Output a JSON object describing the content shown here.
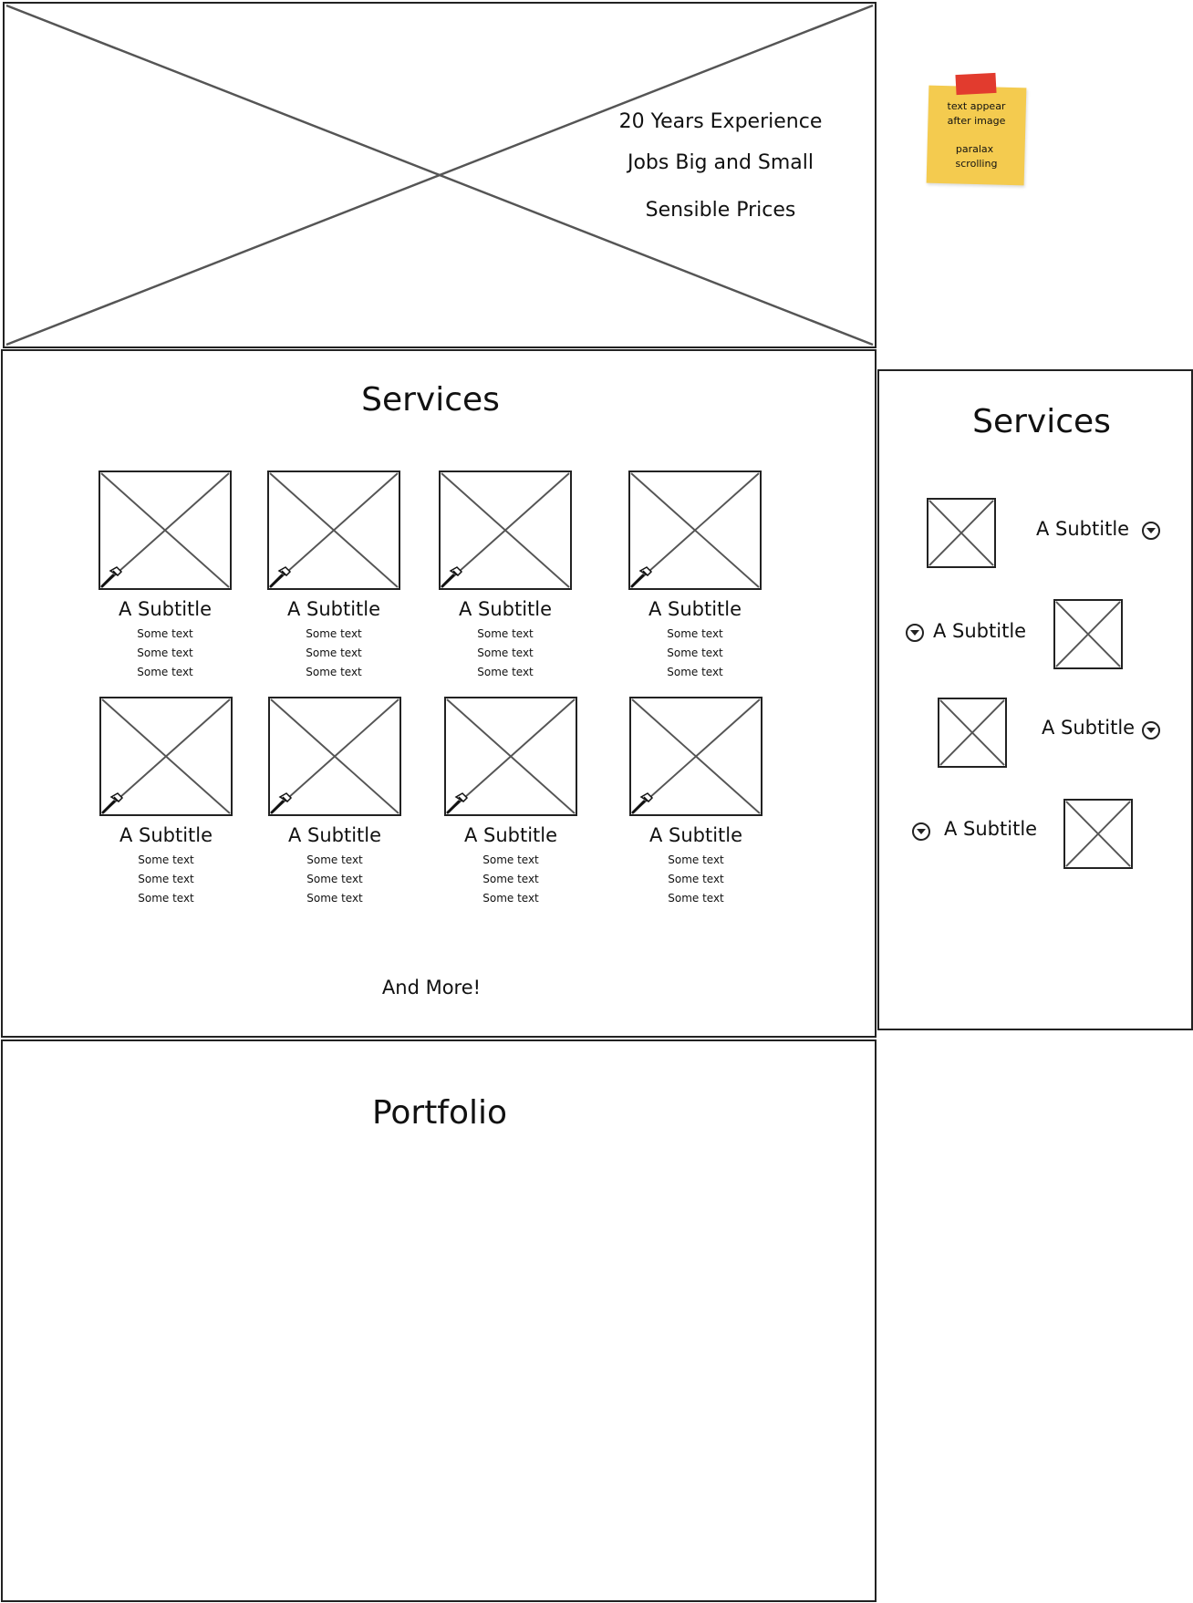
{
  "hero": {
    "lines": [
      "20 Years Experience",
      "Jobs Big and Small",
      "Sensible Prices"
    ]
  },
  "sticky_note": {
    "line1": "text appear",
    "line2": "after image",
    "line3": "paralax",
    "line4": "scrolling"
  },
  "services": {
    "title": "Services",
    "cards": [
      {
        "subtitle": "A Subtitle",
        "texts": [
          "Some text",
          "Some text",
          "Some text"
        ]
      },
      {
        "subtitle": "A Subtitle",
        "texts": [
          "Some text",
          "Some text",
          "Some text"
        ]
      },
      {
        "subtitle": "A Subtitle",
        "texts": [
          "Some text",
          "Some text",
          "Some text"
        ]
      },
      {
        "subtitle": "A Subtitle",
        "texts": [
          "Some text",
          "Some text",
          "Some text"
        ]
      },
      {
        "subtitle": "A Subtitle",
        "texts": [
          "Some text",
          "Some text",
          "Some text"
        ]
      },
      {
        "subtitle": "A Subtitle",
        "texts": [
          "Some text",
          "Some text",
          "Some text"
        ]
      },
      {
        "subtitle": "A Subtitle",
        "texts": [
          "Some text",
          "Some text",
          "Some text"
        ]
      },
      {
        "subtitle": "A Subtitle",
        "texts": [
          "Some text",
          "Some text",
          "Some text"
        ]
      }
    ],
    "more_label": "And More!"
  },
  "mobile_services": {
    "title": "Services",
    "items": [
      {
        "subtitle": "A Subtitle"
      },
      {
        "subtitle": "A Subtitle"
      },
      {
        "subtitle": "A Subtitle"
      },
      {
        "subtitle": "A Subtitle"
      }
    ]
  },
  "portfolio": {
    "title": "Portfolio"
  },
  "icons": {
    "placeholder": "image-placeholder-icon",
    "tool": "hammer-icon",
    "dropdown": "chevron-down-circle-icon"
  }
}
